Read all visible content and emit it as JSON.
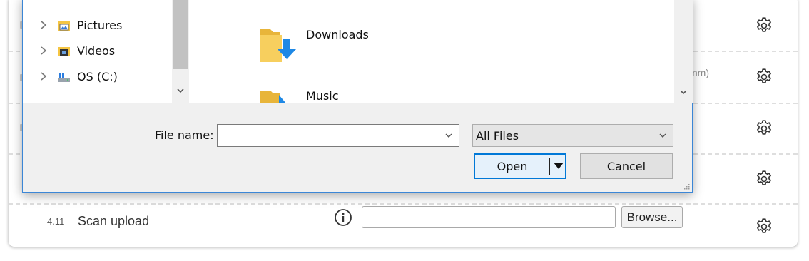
{
  "form": {
    "hint_fragment": "mm)",
    "question": {
      "number": "4.11",
      "label": "Scan upload",
      "browse_label": "Browse..."
    }
  },
  "dialog": {
    "nav_items": [
      {
        "label": "Pictures",
        "icon": "pictures-folder-icon"
      },
      {
        "label": "Videos",
        "icon": "videos-folder-icon"
      },
      {
        "label": "OS (C:)",
        "icon": "drive-icon"
      }
    ],
    "folders": [
      {
        "name": "Downloads",
        "icon": "downloads-folder-icon"
      },
      {
        "name": "Music",
        "icon": "music-folder-icon"
      }
    ],
    "file_name_label": "File name:",
    "file_name_value": "",
    "file_type": "All Files",
    "open_label": "Open",
    "cancel_label": "Cancel"
  },
  "colors": {
    "dialog_border": "#3b86d6",
    "primary_button_border": "#0078d7",
    "folder_yellow": "#f5c542",
    "download_arrow": "#1e88e5"
  }
}
